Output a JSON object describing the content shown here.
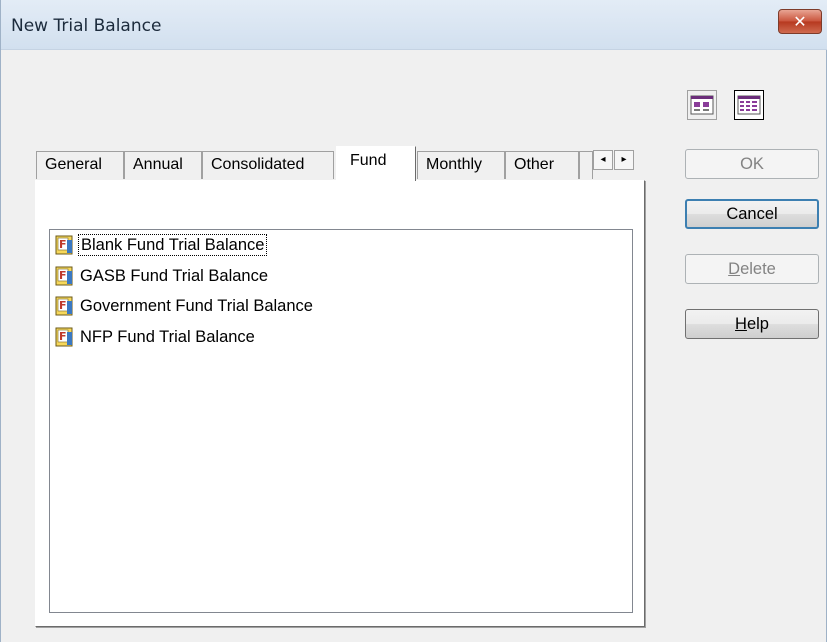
{
  "window": {
    "title": "New Trial Balance",
    "close_label": "✕"
  },
  "view_buttons": [
    {
      "name": "large-icons-view-icon"
    },
    {
      "name": "details-view-icon"
    }
  ],
  "tabs": [
    {
      "label": "General"
    },
    {
      "label": "Annual"
    },
    {
      "label": "Consolidated"
    },
    {
      "label": "Fund",
      "active": true
    },
    {
      "label": "Monthly"
    },
    {
      "label": "Other"
    }
  ],
  "tab_scroll": {
    "left": "◂",
    "right": "▸"
  },
  "list": {
    "items": [
      {
        "label": "Blank Fund Trial Balance",
        "focused": true,
        "icon": "fund-template-icon"
      },
      {
        "label": "GASB Fund Trial Balance",
        "icon": "fund-template-icon"
      },
      {
        "label": "Government Fund Trial Balance",
        "icon": "fund-template-icon"
      },
      {
        "label": "NFP Fund Trial Balance",
        "icon": "fund-template-icon"
      }
    ]
  },
  "buttons": {
    "ok": {
      "label": "OK",
      "enabled": false
    },
    "cancel": {
      "label": "Cancel",
      "enabled": true
    },
    "delete": {
      "mnemonic": "D",
      "rest": "elete",
      "enabled": false
    },
    "help": {
      "mnemonic": "H",
      "rest": "elp",
      "enabled": true
    }
  },
  "colors": {
    "accent": "#3c7fb1",
    "close_button": "#c9533a",
    "icon_red": "#c0392b"
  }
}
